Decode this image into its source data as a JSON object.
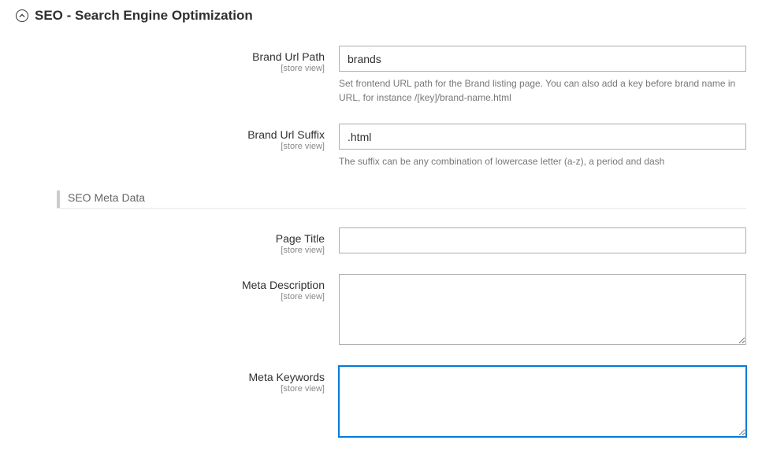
{
  "section": {
    "title": "SEO - Search Engine Optimization"
  },
  "fields": {
    "brand_url_path": {
      "label": "Brand Url Path",
      "scope": "[store view]",
      "value": "brands",
      "help": "Set frontend URL path for the Brand listing page. You can also add a key before brand name in URL, for instance /[key]/brand-name.html"
    },
    "brand_url_suffix": {
      "label": "Brand Url Suffix",
      "scope": "[store view]",
      "value": ".html",
      "help": "The suffix can be any combination of lowercase letter (a-z), a period and dash"
    }
  },
  "subsection": {
    "title": "SEO Meta Data"
  },
  "meta_fields": {
    "page_title": {
      "label": "Page Title",
      "scope": "[store view]",
      "value": ""
    },
    "meta_description": {
      "label": "Meta Description",
      "scope": "[store view]",
      "value": ""
    },
    "meta_keywords": {
      "label": "Meta Keywords",
      "scope": "[store view]",
      "value": ""
    }
  }
}
